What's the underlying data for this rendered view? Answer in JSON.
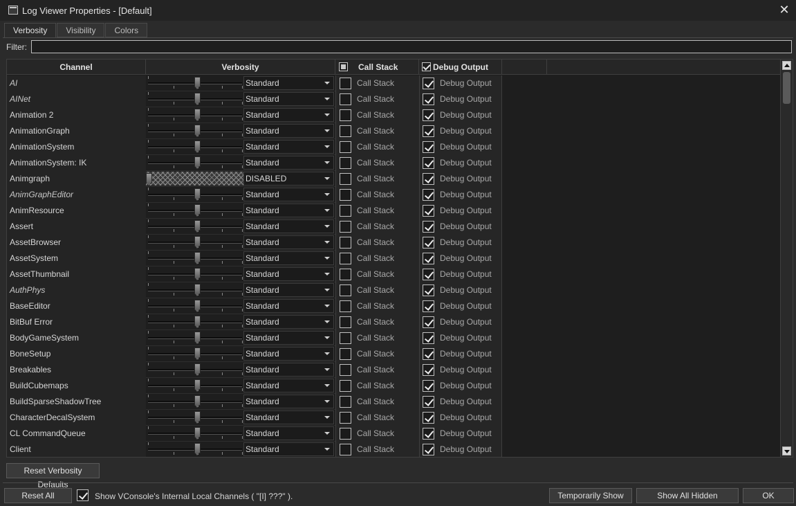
{
  "window": {
    "title": "Log Viewer Properties - [Default]",
    "close_glyph": "✕"
  },
  "tabs": [
    "Verbosity",
    "Visibility",
    "Colors"
  ],
  "filter": {
    "label": "Filter:",
    "value": ""
  },
  "columns": {
    "channel": "Channel",
    "verbosity": "Verbosity",
    "call_stack": "Call Stack",
    "debug_output": "Debug Output"
  },
  "header_checks": {
    "call_stack": "partial",
    "debug_output": "checked"
  },
  "cell_labels": {
    "call_stack": "Call Stack",
    "debug_output": "Debug Output"
  },
  "rows": [
    {
      "name": "AI",
      "italic": true,
      "level": "Standard",
      "call_stack": false,
      "debug_output": true
    },
    {
      "name": "AINet",
      "italic": true,
      "level": "Standard",
      "call_stack": false,
      "debug_output": true
    },
    {
      "name": "Animation 2",
      "italic": false,
      "level": "Standard",
      "call_stack": false,
      "debug_output": true
    },
    {
      "name": "AnimationGraph",
      "italic": false,
      "level": "Standard",
      "call_stack": false,
      "debug_output": true
    },
    {
      "name": "AnimationSystem",
      "italic": false,
      "level": "Standard",
      "call_stack": false,
      "debug_output": true
    },
    {
      "name": "AnimationSystem: IK",
      "italic": false,
      "level": "Standard",
      "call_stack": false,
      "debug_output": true
    },
    {
      "name": "Animgraph",
      "italic": false,
      "level": "DISABLED",
      "call_stack": false,
      "debug_output": true
    },
    {
      "name": "AnimGraphEditor",
      "italic": true,
      "level": "Standard",
      "call_stack": false,
      "debug_output": true
    },
    {
      "name": "AnimResource",
      "italic": false,
      "level": "Standard",
      "call_stack": false,
      "debug_output": true
    },
    {
      "name": "Assert",
      "italic": false,
      "level": "Standard",
      "call_stack": false,
      "debug_output": true
    },
    {
      "name": "AssetBrowser",
      "italic": false,
      "level": "Standard",
      "call_stack": false,
      "debug_output": true
    },
    {
      "name": "AssetSystem",
      "italic": false,
      "level": "Standard",
      "call_stack": false,
      "debug_output": true
    },
    {
      "name": "AssetThumbnail",
      "italic": false,
      "level": "Standard",
      "call_stack": false,
      "debug_output": true
    },
    {
      "name": "AuthPhys",
      "italic": true,
      "level": "Standard",
      "call_stack": false,
      "debug_output": true
    },
    {
      "name": "BaseEditor",
      "italic": false,
      "level": "Standard",
      "call_stack": false,
      "debug_output": true
    },
    {
      "name": "BitBuf Error",
      "italic": false,
      "level": "Standard",
      "call_stack": false,
      "debug_output": true
    },
    {
      "name": "BodyGameSystem",
      "italic": false,
      "level": "Standard",
      "call_stack": false,
      "debug_output": true
    },
    {
      "name": "BoneSetup",
      "italic": false,
      "level": "Standard",
      "call_stack": false,
      "debug_output": true
    },
    {
      "name": "Breakables",
      "italic": false,
      "level": "Standard",
      "call_stack": false,
      "debug_output": true
    },
    {
      "name": "BuildCubemaps",
      "italic": false,
      "level": "Standard",
      "call_stack": false,
      "debug_output": true
    },
    {
      "name": "BuildSparseShadowTree",
      "italic": false,
      "level": "Standard",
      "call_stack": false,
      "debug_output": true
    },
    {
      "name": "CharacterDecalSystem",
      "italic": false,
      "level": "Standard",
      "call_stack": false,
      "debug_output": true
    },
    {
      "name": "CL CommandQueue",
      "italic": false,
      "level": "Standard",
      "call_stack": false,
      "debug_output": true
    },
    {
      "name": "Client",
      "italic": false,
      "level": "Standard",
      "call_stack": false,
      "debug_output": true
    }
  ],
  "footer": {
    "reset_verbosity": "Reset Verbosity Defaults",
    "reset_all": "Reset All Settings",
    "show_internal_checked": true,
    "show_internal_label": "Show VConsole's Internal Local Channels ( \"[I] ???\" ).",
    "temporarily_show_all": "Temporarily Show All",
    "show_all_hidden": "Show All Hidden Channels",
    "ok": "OK"
  }
}
